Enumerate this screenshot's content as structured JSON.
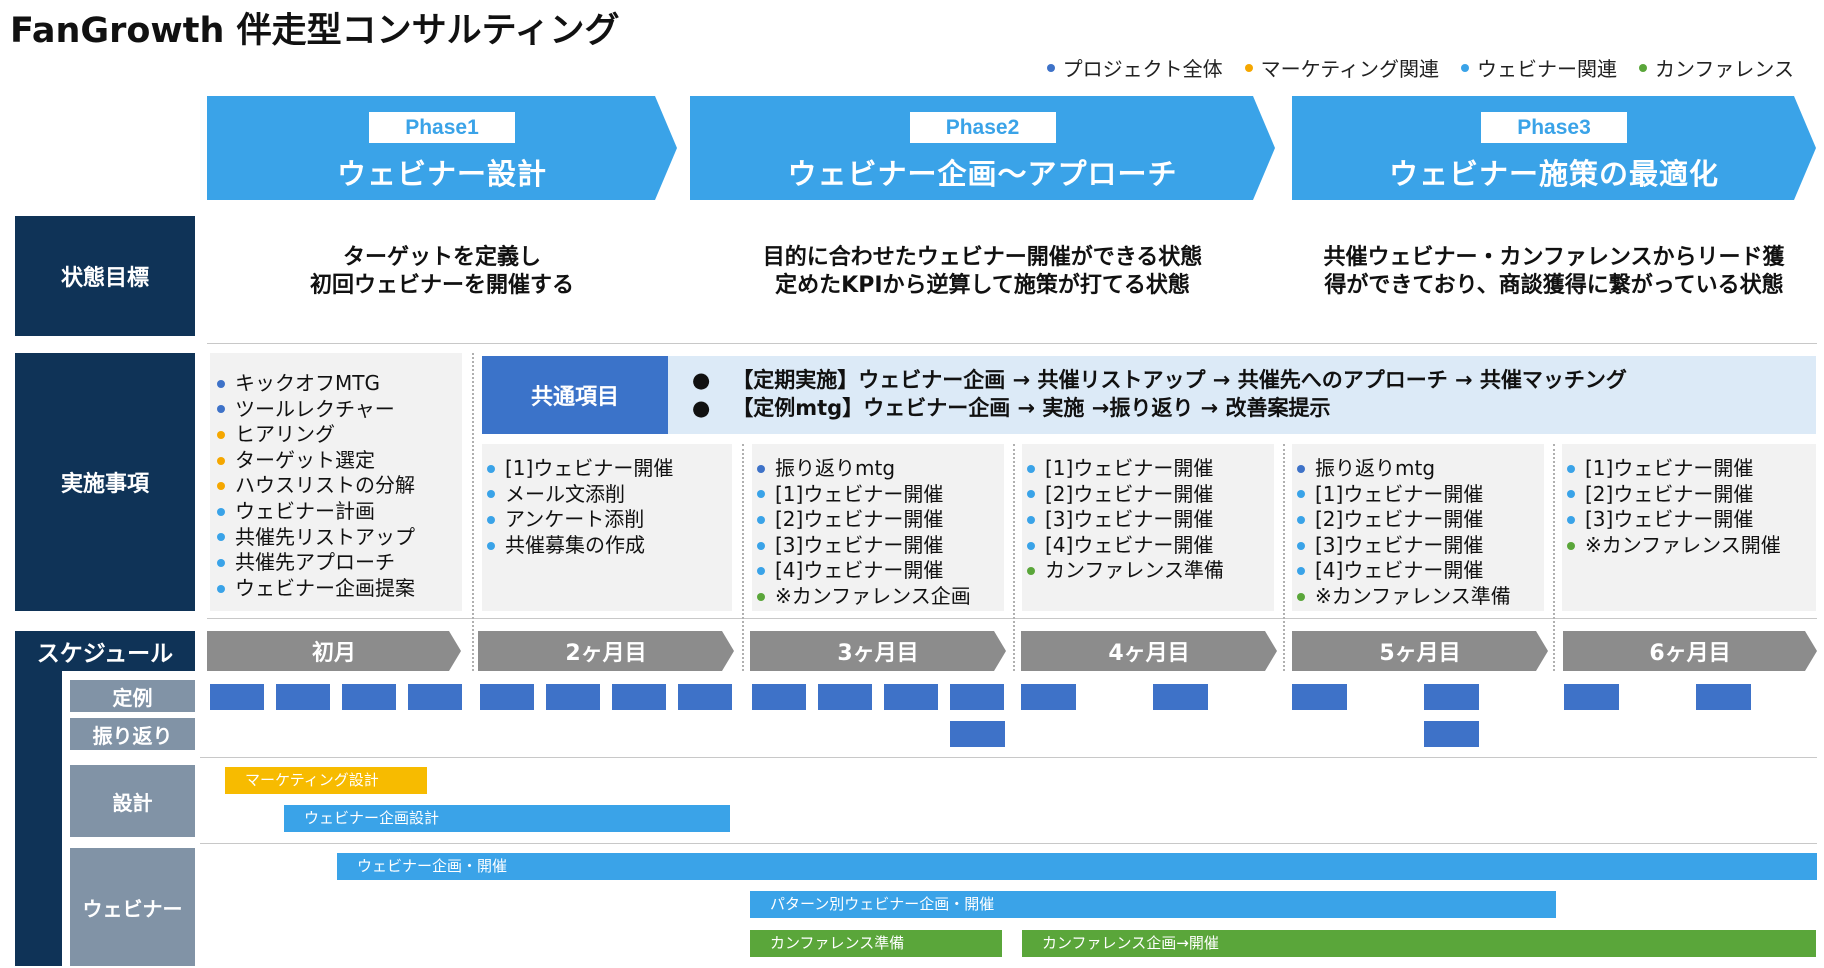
{
  "title": "FanGrowth 伴走型コンサルティング",
  "legend": [
    {
      "label": "プロジェクト全体",
      "color": "#3e72c8"
    },
    {
      "label": "マーケティング関連",
      "color": "#f5a700"
    },
    {
      "label": "ウェビナー関連",
      "color": "#3aa3e8"
    },
    {
      "label": "カンファレンス",
      "color": "#5aa63a"
    }
  ],
  "phases": [
    {
      "badge": "Phase1",
      "name": "ウェビナー設計"
    },
    {
      "badge": "Phase2",
      "name": "ウェビナー企画～アプローチ"
    },
    {
      "badge": "Phase3",
      "name": "ウェビナー施策の最適化"
    }
  ],
  "row_labels": {
    "goal": "状態目標",
    "tasks": "実施事項",
    "schedule": "スケジュール",
    "regular": "定例",
    "review": "振り返り",
    "design": "設計",
    "webinar": "ウェビナー"
  },
  "goals": [
    {
      "line1": "ターゲットを定義し",
      "line2": "初回ウェビナーを開催する"
    },
    {
      "line1": "目的に合わせたウェビナー開催ができる状態",
      "line2": "定めたKPIから逆算して施策が打てる状態"
    },
    {
      "line1": "共催ウェビナー・カンファレンスからリード獲",
      "line2": "得ができており、商談獲得に繋がっている状態"
    }
  ],
  "common": {
    "label": "共通項目",
    "line1": "【定期実施】ウェビナー企画 → 共催リストアップ → 共催先へのアプローチ → 共催マッチング",
    "line2": "【定例mtg】ウェビナー企画 → 実施 →振り返り → 改善案提示"
  },
  "task_columns": [
    {
      "items": [
        {
          "text": "キックオフMTG",
          "color": "#3e72c8"
        },
        {
          "text": "ツールレクチャー",
          "color": "#3e72c8"
        },
        {
          "text": "ヒアリング",
          "color": "#f5a700"
        },
        {
          "text": "ターゲット選定",
          "color": "#f5a700"
        },
        {
          "text": "ハウスリストの分解",
          "color": "#f5a700"
        },
        {
          "text": "ウェビナー計画",
          "color": "#3aa3e8"
        },
        {
          "text": "共催先リストアップ",
          "color": "#3aa3e8"
        },
        {
          "text": "共催先アプローチ",
          "color": "#3aa3e8"
        },
        {
          "text": "ウェビナー企画提案",
          "color": "#3aa3e8"
        }
      ]
    },
    {
      "items": [
        {
          "text": "[1]ウェビナー開催",
          "color": "#3aa3e8"
        },
        {
          "text": "メール文添削",
          "color": "#3aa3e8"
        },
        {
          "text": "アンケート添削",
          "color": "#3aa3e8"
        },
        {
          "text": "共催募集の作成",
          "color": "#3aa3e8"
        }
      ]
    },
    {
      "items": [
        {
          "text": "振り返りmtg",
          "color": "#3e72c8"
        },
        {
          "text": "[1]ウェビナー開催",
          "color": "#3aa3e8"
        },
        {
          "text": "[2]ウェビナー開催",
          "color": "#3aa3e8"
        },
        {
          "text": "[3]ウェビナー開催",
          "color": "#3aa3e8"
        },
        {
          "text": "[4]ウェビナー開催",
          "color": "#3aa3e8"
        },
        {
          "text": "※カンファレンス企画",
          "color": "#5aa63a"
        }
      ]
    },
    {
      "items": [
        {
          "text": "[1]ウェビナー開催",
          "color": "#3aa3e8"
        },
        {
          "text": "[2]ウェビナー開催",
          "color": "#3aa3e8"
        },
        {
          "text": "[3]ウェビナー開催",
          "color": "#3aa3e8"
        },
        {
          "text": "[4]ウェビナー開催",
          "color": "#3aa3e8"
        },
        {
          "text": "カンファレンス準備",
          "color": "#5aa63a"
        }
      ]
    },
    {
      "items": [
        {
          "text": "振り返りmtg",
          "color": "#3e72c8"
        },
        {
          "text": "[1]ウェビナー開催",
          "color": "#3aa3e8"
        },
        {
          "text": "[2]ウェビナー開催",
          "color": "#3aa3e8"
        },
        {
          "text": "[3]ウェビナー開催",
          "color": "#3aa3e8"
        },
        {
          "text": "[4]ウェビナー開催",
          "color": "#3aa3e8"
        },
        {
          "text": "※カンファレンス準備",
          "color": "#5aa63a"
        }
      ]
    },
    {
      "items": [
        {
          "text": "[1]ウェビナー開催",
          "color": "#3aa3e8"
        },
        {
          "text": "[2]ウェビナー開催",
          "color": "#3aa3e8"
        },
        {
          "text": "[3]ウェビナー開催",
          "color": "#3aa3e8"
        },
        {
          "text": "※カンファレンス開催",
          "color": "#5aa63a"
        }
      ]
    }
  ],
  "months": [
    "初月",
    "2ヶ月目",
    "3ヶ月目",
    "4ヶ月目",
    "5ヶ月目",
    "6ヶ月目"
  ],
  "bars": {
    "marketing_design": {
      "label": "マーケティング設計",
      "color": "#f7bb00"
    },
    "webinar_plan_design": {
      "label": "ウェビナー企画設計",
      "color": "#3aa3e8"
    },
    "webinar_plan_hold": {
      "label": "ウェビナー企画・開催",
      "color": "#3aa3e8"
    },
    "pattern_webinar": {
      "label": "パターン別ウェビナー企画・開催",
      "color": "#3aa3e8"
    },
    "conference_prep": {
      "label": "カンファレンス準備",
      "color": "#5aa63a"
    },
    "conference_hold": {
      "label": "カンファレンス企画→開催",
      "color": "#5aa63a"
    }
  }
}
